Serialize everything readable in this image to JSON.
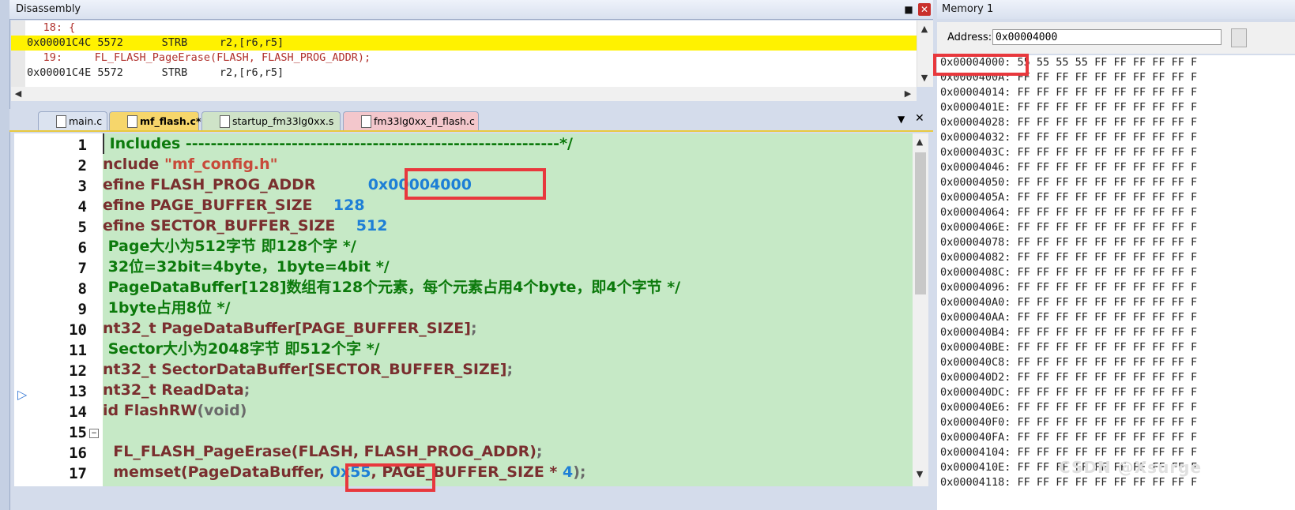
{
  "disassembly": {
    "title": "Disassembly",
    "pin_glyph": "■",
    "close_glyph": "✕",
    "lines": [
      "     18: {",
      "0x00001C4C 5572      STRB     r2,[r6,r5]",
      "     19:     FL_FLASH_PageErase(FLASH, FLASH_PROG_ADDR);",
      "0x00001C4E 5572      STRB     r2,[r6,r5]"
    ]
  },
  "tabs": [
    {
      "label": "main.c"
    },
    {
      "label": "mf_flash.c*"
    },
    {
      "label": "startup_fm33lg0xx.s"
    },
    {
      "label": "fm33lg0xx_fl_flash.c"
    }
  ],
  "tabbar": {
    "dropdown_glyph": "▼",
    "close_glyph": "✕"
  },
  "editor": {
    "line_numbers": [
      "1",
      "2",
      "3",
      "4",
      "5",
      "6",
      "7",
      "8",
      "9",
      "10",
      "11",
      "12",
      "13",
      "14",
      "15",
      "16",
      "17"
    ],
    "lines": {
      "l1": " Includes ------------------------------------------------------------*/",
      "l2a": "nclude ",
      "l2b": "\"mf_config.h\"",
      "l3a": "efine FLASH_PROG_ADDR          ",
      "l3b": "0x00004000",
      "l4a": "efine PAGE_BUFFER_SIZE    ",
      "l4b": "128",
      "l5a": "efine SECTOR_BUFFER_SIZE    ",
      "l5b": "512",
      "l6": " Page大小为512字节 即128个字 */",
      "l7": " 32位=32bit=4byte，1byte=4bit */",
      "l8": " PageDataBuffer[128]数组有128个元素，每个元素占用4个byte，即4个字节 */",
      "l9": " 1byte占用8位 */",
      "l10a": "nt32_t PageDataBuffer[PAGE_BUFFER_SIZE]",
      "l10b": ";",
      "l11": " Sector大小为2048字节 即512个字 */",
      "l12a": "nt32_t SectorDataBuffer[SECTOR_BUFFER_SIZE]",
      "l12b": ";",
      "l13a": "nt32_t ReadData",
      "l13b": ";",
      "l14a": "id FlashRW",
      "l14b": "(void)",
      "l16a": "  FL_FLASH_PageErase(FLASH, FLASH_PROG_ADDR)",
      "l16b": ";",
      "l17a": "  memset(PageDataBuffer, ",
      "l17b": "0x55",
      "l17c": ", PAGE_BUFFER_SIZE * ",
      "l17d": "4",
      "l17e": ");"
    }
  },
  "memory": {
    "title": "Memory 1",
    "address_label": "Address:",
    "address_value": "0x00004000",
    "rows": [
      "0x00004000: 55 55 55 55 FF FF FF FF FF F",
      "0x0000400A: FF FF FF FF FF FF FF FF FF F",
      "0x00004014: FF FF FF FF FF FF FF FF FF F",
      "0x0000401E: FF FF FF FF FF FF FF FF FF F",
      "0x00004028: FF FF FF FF FF FF FF FF FF F",
      "0x00004032: FF FF FF FF FF FF FF FF FF F",
      "0x0000403C: FF FF FF FF FF FF FF FF FF F",
      "0x00004046: FF FF FF FF FF FF FF FF FF F",
      "0x00004050: FF FF FF FF FF FF FF FF FF F",
      "0x0000405A: FF FF FF FF FF FF FF FF FF F",
      "0x00004064: FF FF FF FF FF FF FF FF FF F",
      "0x0000406E: FF FF FF FF FF FF FF FF FF F",
      "0x00004078: FF FF FF FF FF FF FF FF FF F",
      "0x00004082: FF FF FF FF FF FF FF FF FF F",
      "0x0000408C: FF FF FF FF FF FF FF FF FF F",
      "0x00004096: FF FF FF FF FF FF FF FF FF F",
      "0x000040A0: FF FF FF FF FF FF FF FF FF F",
      "0x000040AA: FF FF FF FF FF FF FF FF FF F",
      "0x000040B4: FF FF FF FF FF FF FF FF FF F",
      "0x000040BE: FF FF FF FF FF FF FF FF FF F",
      "0x000040C8: FF FF FF FF FF FF FF FF FF F",
      "0x000040D2: FF FF FF FF FF FF FF FF FF F",
      "0x000040DC: FF FF FF FF FF FF FF FF FF F",
      "0x000040E6: FF FF FF FF FF FF FF FF FF F",
      "0x000040F0: FF FF FF FF FF FF FF FF FF F",
      "0x000040FA: FF FF FF FF FF FF FF FF FF F",
      "0x00004104: FF FF FF FF FF FF FF FF FF F",
      "0x0000410E: FF FF FF FF FF FF FF FF FF F",
      "0x00004118: FF FF FF FF FF FF FF FF FF F"
    ]
  },
  "watermark": "CSDN @Xsurge",
  "colors": {
    "highlight_line": "#fff200",
    "editor_bg": "#c6e9c6",
    "annotation_box": "#e8383d",
    "comment": "#0c7a0c"
  }
}
